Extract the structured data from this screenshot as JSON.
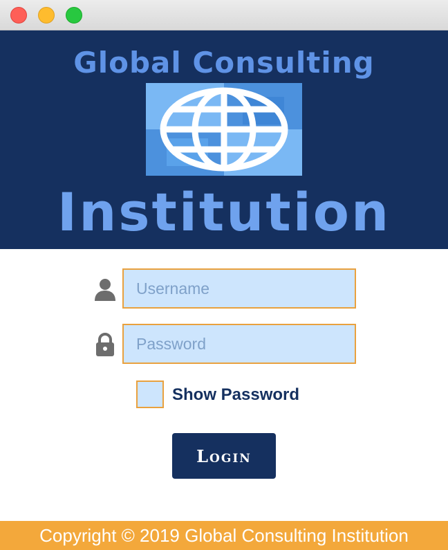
{
  "window": {
    "controls": [
      "close",
      "minimize",
      "maximize"
    ]
  },
  "banner": {
    "title_top": "Global Consulting",
    "title_bottom": "Institution",
    "logo_icon": "globe-icon"
  },
  "login_form": {
    "username": {
      "placeholder": "Username",
      "value": "",
      "icon": "user-icon"
    },
    "password": {
      "placeholder": "Password",
      "value": "",
      "icon": "lock-icon"
    },
    "show_password": {
      "label": "Show Password",
      "checked": false
    },
    "login_button_label": "Login"
  },
  "footer": {
    "text": "Copyright © 2019 Global Consulting Institution"
  },
  "colors": {
    "banner_bg": "#15305f",
    "field_bg": "#cde5fd",
    "field_border": "#e9a13e",
    "button_bg": "#15305f",
    "footer_bg": "#f3a83b"
  }
}
